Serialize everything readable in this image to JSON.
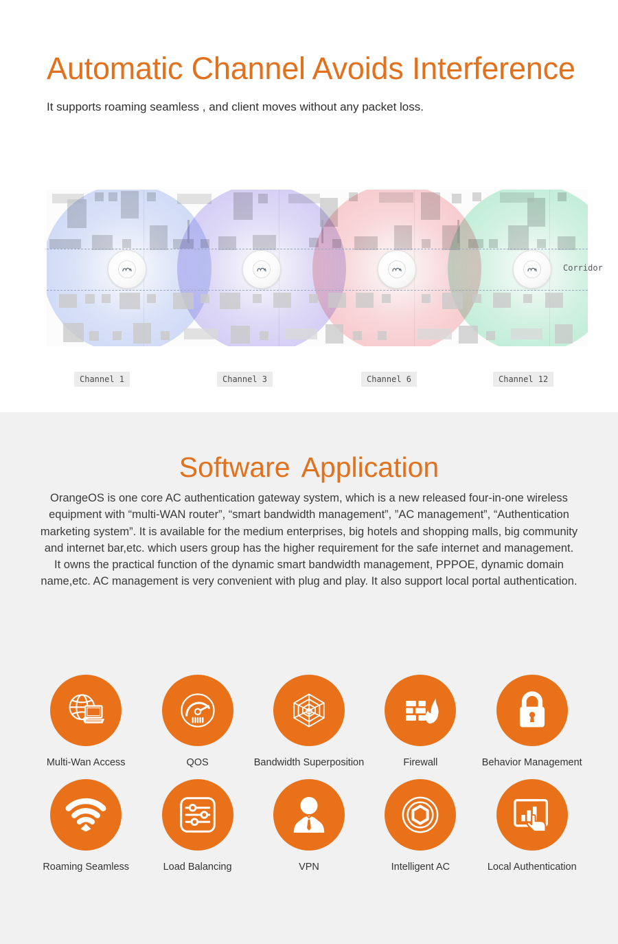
{
  "hero": {
    "title": "Automatic Channel Avoids Interference",
    "subtitle": "It supports roaming seamless , and client moves without any packet loss.",
    "accent_color": "#E2711D"
  },
  "diagram": {
    "corridor_label": "Corridor",
    "access_point_icon": "access-point-icon",
    "channels": [
      {
        "label": "Channel 1",
        "color": "#aebef0"
      },
      {
        "label": "Channel 3",
        "color": "#b3a9ef"
      },
      {
        "label": "Channel 6",
        "color": "#f2a9ad"
      },
      {
        "label": "Channel 12",
        "color": "#9fe2c4"
      }
    ]
  },
  "software": {
    "title_part1": "Software",
    "title_part2": "Application",
    "body": "OrangeOS is one core AC authentication gateway system, which is a new released four-in-one wireless equipment with “multi-WAN router”, “smart bandwidth management”, ”AC management”, “Authentication marketing system”. It is available for the medium enterprises, big hotels and shopping malls, big community and internet bar,etc. which users group has the higher requirement for the safe internet and management. It owns the practical function of the dynamic smart bandwidth management, PPPOE, dynamic domain name,etc. AC management is very convenient with plug and play. It also support local portal authentication.",
    "accent_color": "#E2711D",
    "background_color": "#F1F1F1"
  },
  "features": {
    "disc_color": "#E8711A",
    "row1": [
      {
        "label": "Multi-Wan Access",
        "icon": "globe-laptop-icon"
      },
      {
        "label": "QOS",
        "icon": "speedometer-icon"
      },
      {
        "label": "Bandwidth Superposition",
        "icon": "spider-web-icon"
      },
      {
        "label": "Firewall",
        "icon": "firewall-flame-icon"
      },
      {
        "label": "Behavior Management",
        "icon": "padlock-icon"
      }
    ],
    "row2": [
      {
        "label": "Roaming Seamless",
        "icon": "wifi-signal-icon"
      },
      {
        "label": "Load Balancing",
        "icon": "sliders-icon"
      },
      {
        "label": "VPN",
        "icon": "user-tie-icon"
      },
      {
        "label": "Intelligent AC",
        "icon": "hexagon-target-icon"
      },
      {
        "label": "Local Authentication",
        "icon": "touch-chart-icon"
      }
    ]
  }
}
